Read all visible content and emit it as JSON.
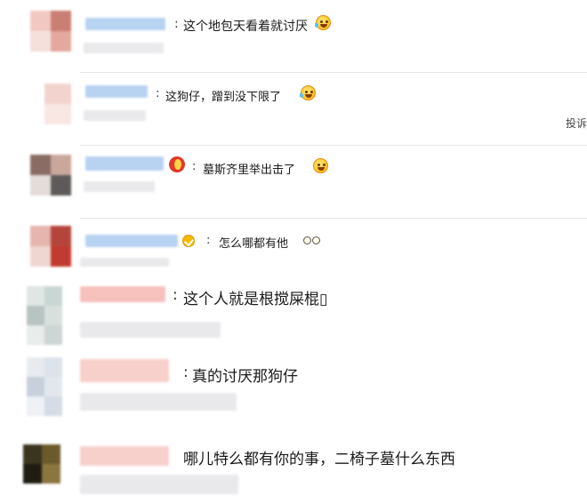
{
  "comments": [
    {
      "id": "c1",
      "separator": ":",
      "text": "这个地包天看着就讨厌",
      "emoji": "cry-laugh-icon"
    },
    {
      "id": "c2",
      "separator": ":",
      "text": "这狗仔，蹭到没下限了",
      "emoji": "cry-laugh-icon"
    },
    {
      "id": "c3",
      "separator": ":",
      "text": "墓斯齐里举出击了",
      "emoji": "wink-grin-icon"
    },
    {
      "id": "c4",
      "separator": ":",
      "text": "怎么哪都有他",
      "emoji": "sunglasses-icon"
    },
    {
      "id": "c5",
      "separator": ":",
      "text": "这个人就是根搅屎棍▯",
      "emoji": ""
    },
    {
      "id": "c6",
      "separator": ":",
      "text": "真的讨厌那狗仔",
      "emoji": ""
    },
    {
      "id": "c7",
      "separator": "",
      "text": "哪儿特么都有你的事，二椅子墓什么东西",
      "emoji": ""
    }
  ],
  "side": {
    "partial_label": "投诉"
  },
  "colors": {
    "name_blue": "#a9c8f0",
    "name_pink": "#f6c1bd",
    "divider": "#e6e6e6",
    "meta_gray": "#e9e9ec"
  }
}
